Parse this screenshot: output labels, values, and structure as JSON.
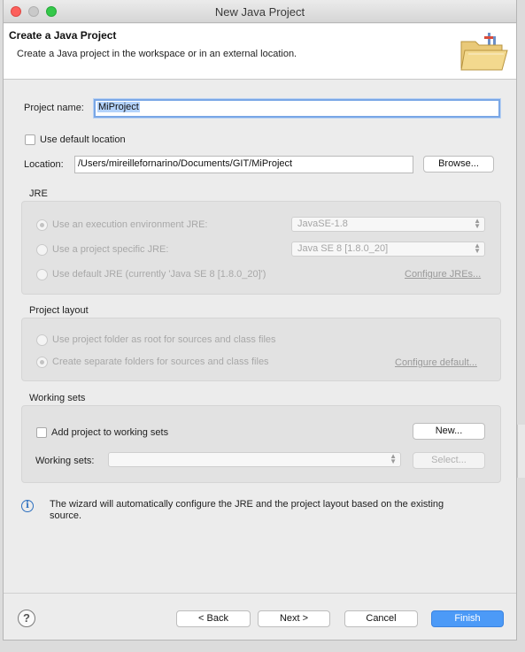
{
  "window": {
    "title": "New Java Project"
  },
  "banner": {
    "title": "Create a Java Project",
    "description": "Create a Java project in the workspace or in an external location."
  },
  "project": {
    "name_label": "Project name:",
    "name_value": "MiProject",
    "use_default_location_label": "Use default location",
    "use_default_location_checked": false,
    "location_label": "Location:",
    "location_value": "/Users/mireillefornarino/Documents/GIT/MiProject",
    "browse_label": "Browse..."
  },
  "jre": {
    "section_label": "JRE",
    "option_env_label": "Use an execution environment JRE:",
    "option_env_value": "JavaSE-1.8",
    "option_specific_label": "Use a project specific JRE:",
    "option_specific_value": "Java SE 8 [1.8.0_20]",
    "option_default_label": "Use default JRE (currently 'Java SE 8 [1.8.0_20]')",
    "configure_link": "Configure JREs..."
  },
  "layout": {
    "section_label": "Project layout",
    "option_root_label": "Use project folder as root for sources and class files",
    "option_separate_label": "Create separate folders for sources and class files",
    "configure_link": "Configure default..."
  },
  "working_sets": {
    "section_label": "Working sets",
    "add_label": "Add project to working sets",
    "add_checked": false,
    "new_button": "New...",
    "sets_label": "Working sets:",
    "sets_value": "",
    "select_button": "Select..."
  },
  "info": {
    "icon": "info-icon",
    "text": "The wizard will automatically configure the JRE and the project layout based on the existing source."
  },
  "footer": {
    "back": "< Back",
    "next": "Next >",
    "cancel": "Cancel",
    "finish": "Finish"
  },
  "colors": {
    "accent": "#4c9af7",
    "window_bg": "#ececec",
    "group_bg": "#e2e2e2"
  }
}
